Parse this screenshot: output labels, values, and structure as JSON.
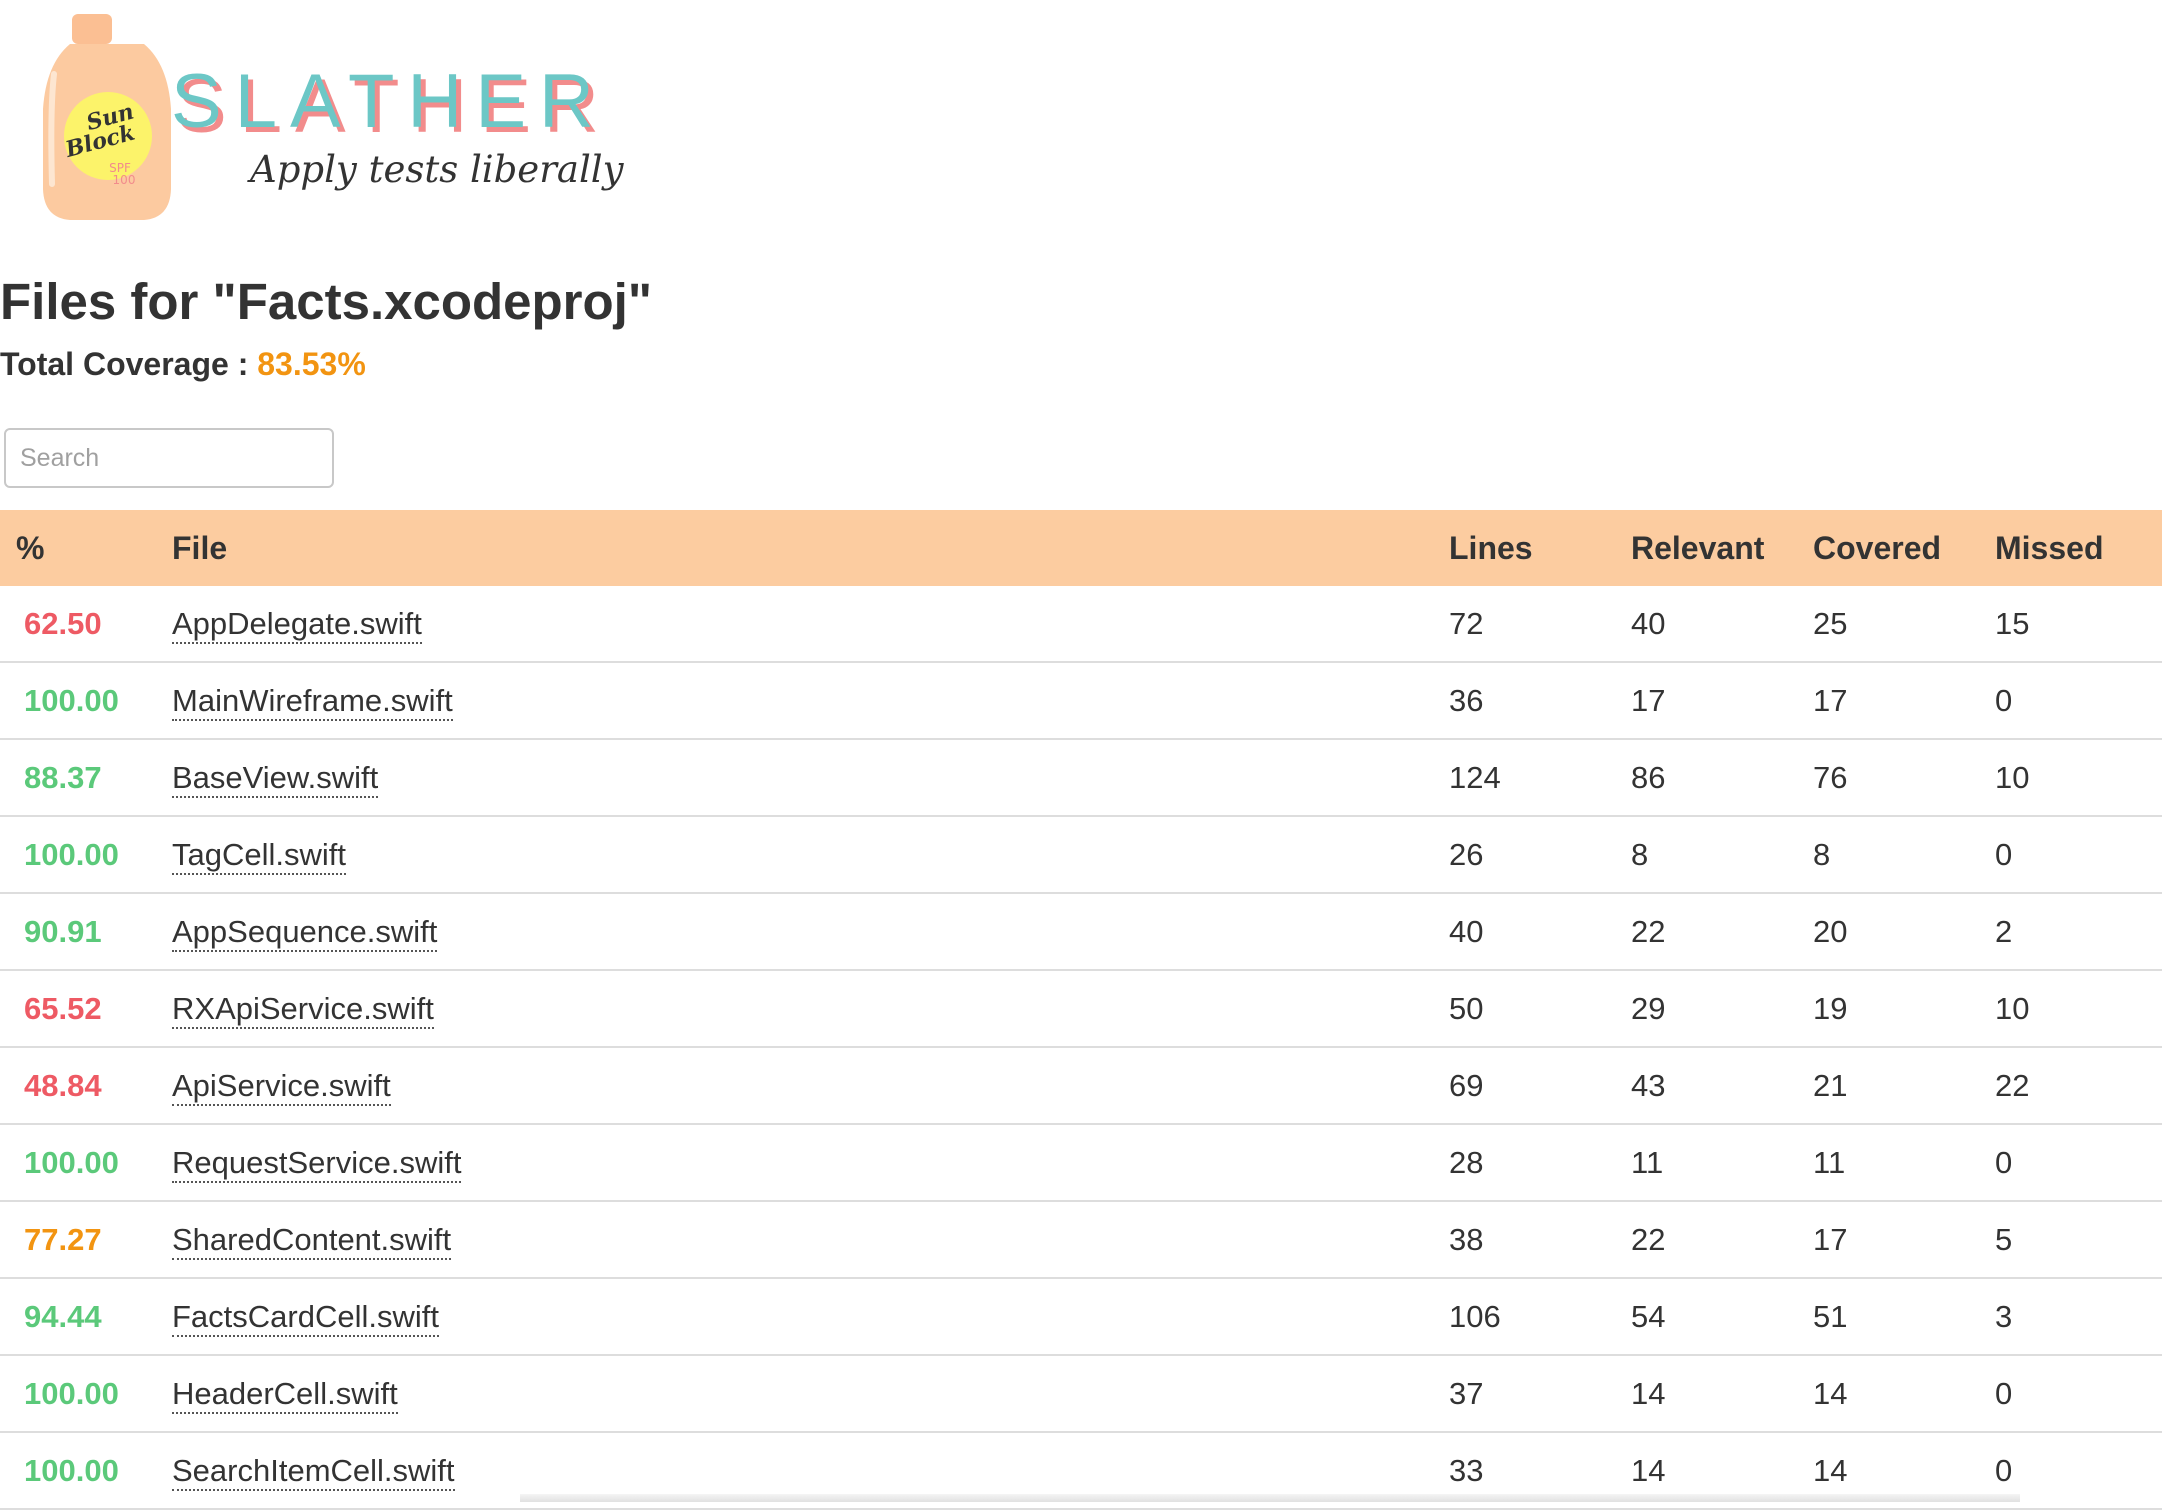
{
  "logo": {
    "brand": "SLATHER",
    "tagline": "Apply tests liberally",
    "bottle_text_1": "Sun",
    "bottle_text_2": "Block",
    "bottle_text_3": "SPF",
    "bottle_text_4": "100"
  },
  "header": {
    "title": "Files for \"Facts.xcodeproj\"",
    "coverage_label": "Total Coverage :",
    "coverage_value": "83.53%"
  },
  "search": {
    "placeholder": "Search"
  },
  "table": {
    "columns": [
      "%",
      "File",
      "Lines",
      "Relevant",
      "Covered",
      "Missed"
    ],
    "rows": [
      {
        "pct": "62.50",
        "file": "AppDelegate.swift",
        "lines": "72",
        "relevant": "40",
        "covered": "25",
        "missed": "15",
        "level": "red"
      },
      {
        "pct": "100.00",
        "file": "MainWireframe.swift",
        "lines": "36",
        "relevant": "17",
        "covered": "17",
        "missed": "0",
        "level": "green"
      },
      {
        "pct": "88.37",
        "file": "BaseView.swift",
        "lines": "124",
        "relevant": "86",
        "covered": "76",
        "missed": "10",
        "level": "green"
      },
      {
        "pct": "100.00",
        "file": "TagCell.swift",
        "lines": "26",
        "relevant": "8",
        "covered": "8",
        "missed": "0",
        "level": "green"
      },
      {
        "pct": "90.91",
        "file": "AppSequence.swift",
        "lines": "40",
        "relevant": "22",
        "covered": "20",
        "missed": "2",
        "level": "green"
      },
      {
        "pct": "65.52",
        "file": "RXApiService.swift",
        "lines": "50",
        "relevant": "29",
        "covered": "19",
        "missed": "10",
        "level": "red"
      },
      {
        "pct": "48.84",
        "file": "ApiService.swift",
        "lines": "69",
        "relevant": "43",
        "covered": "21",
        "missed": "22",
        "level": "red"
      },
      {
        "pct": "100.00",
        "file": "RequestService.swift",
        "lines": "28",
        "relevant": "11",
        "covered": "11",
        "missed": "0",
        "level": "green"
      },
      {
        "pct": "77.27",
        "file": "SharedContent.swift",
        "lines": "38",
        "relevant": "22",
        "covered": "17",
        "missed": "5",
        "level": "orange"
      },
      {
        "pct": "94.44",
        "file": "FactsCardCell.swift",
        "lines": "106",
        "relevant": "54",
        "covered": "51",
        "missed": "3",
        "level": "green"
      },
      {
        "pct": "100.00",
        "file": "HeaderCell.swift",
        "lines": "37",
        "relevant": "14",
        "covered": "14",
        "missed": "0",
        "level": "green"
      },
      {
        "pct": "100.00",
        "file": "SearchItemCell.swift",
        "lines": "33",
        "relevant": "14",
        "covered": "14",
        "missed": "0",
        "level": "green"
      }
    ]
  },
  "colors": {
    "header_bg": "#fccca0",
    "good": "#5bc97a",
    "bad": "#ee5a64",
    "medium": "#f29411",
    "brand_teal": "#6cc7c6",
    "brand_shadow": "#f28c8c"
  }
}
